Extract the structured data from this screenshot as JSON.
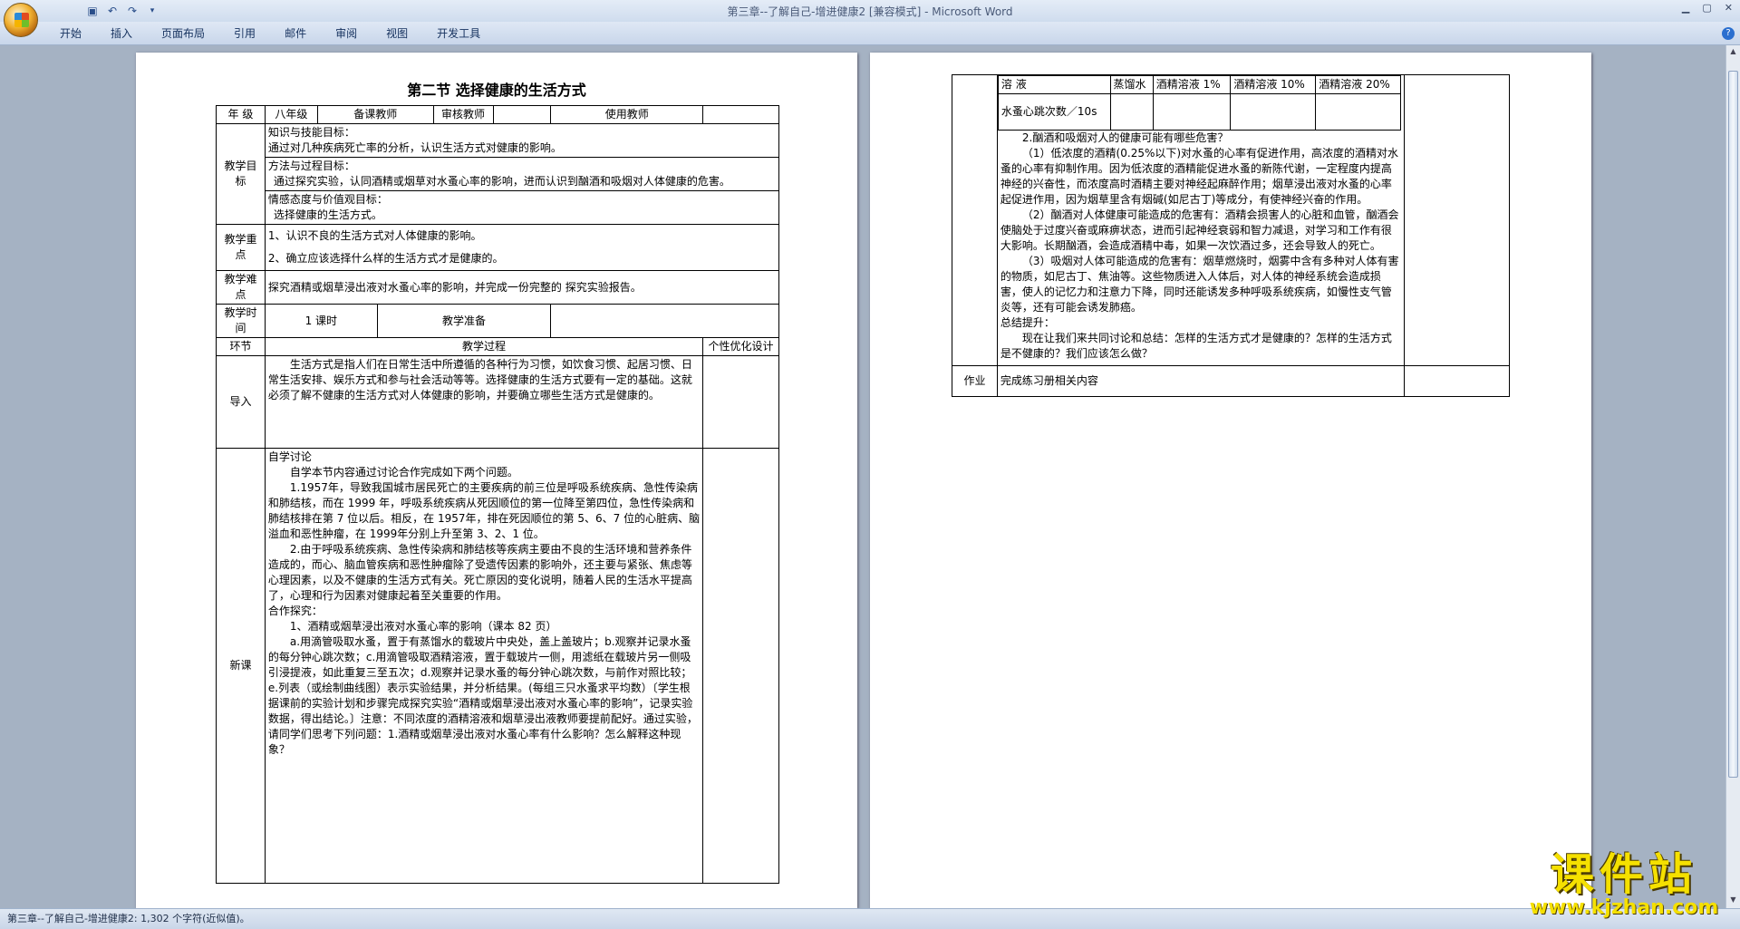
{
  "window": {
    "title": "第三章--了解自己-增进健康2 [兼容模式] - Microsoft Word"
  },
  "ribbon": {
    "tabs": [
      "开始",
      "插入",
      "页面布局",
      "引用",
      "邮件",
      "审阅",
      "视图",
      "开发工具"
    ]
  },
  "status": {
    "text": "第三章--了解自己-增进健康2: 1,302 个字符(近似值)。"
  },
  "watermark": {
    "title": "课件站",
    "url": "www.kjzhan.com"
  },
  "page1": {
    "title": "第二节 选择健康的生活方式",
    "row_grade": {
      "l1": "年  级",
      "v1": "八年级",
      "l2": "备课教师",
      "l3": "审核教师",
      "l4": "使用教师"
    },
    "goals": {
      "label": "教学目标",
      "h1": "知识与技能目标：",
      "t1": "通过对几种疾病死亡率的分析，认识生活方式对健康的影响。",
      "h2": "方法与过程目标：",
      "t2": "通过探究实验，认同酒精或烟草对水蚤心率的影响，进而认识到酗酒和吸烟对人体健康的危害。",
      "h3": "情感态度与价值观目标：",
      "t3": "选择健康的生活方式。"
    },
    "keypoints": {
      "label": "教学重点",
      "k1": "1、认识不良的生活方式对人体健康的影响。",
      "k2": "2、确立应该选择什么样的生活方式才是健康的。"
    },
    "difficulty": {
      "label": "教学难点",
      "text": "探究酒精或烟草浸出液对水蚤心率的影响，并完成一份完整的   探究实验报告。"
    },
    "time": {
      "label": "教学时间",
      "value": "1  课时",
      "prep": "教学准备"
    },
    "header": {
      "c1": "环节",
      "c2": "教学过程",
      "c3": "个性优化设计"
    },
    "intro": {
      "label": "导入",
      "text": "生活方式是指人们在日常生活中所遵循的各种行为习惯，如饮食习惯、起居习惯、日常生活安排、娱乐方式和参与社会活动等等。选择健康的生活方式要有一定的基础。这就必须了解不健康的生活方式对人体健康的影响，并要确立哪些生活方式是健康的。"
    },
    "lesson": {
      "label": "新课",
      "h1": "自学讨论",
      "p1": "自学本节内容通过讨论合作完成如下两个问题。",
      "p2": "1.1957年，导致我国城市居民死亡的主要疾病的前三位是呼吸系统疾病、急性传染病和肺结核，而在 1999 年，呼吸系统疾病从死因顺位的第一位降至第四位，急性传染病和肺结核排在第 7 位以后。相反，在 1957年，排在死因顺位的第 5、6、7 位的心脏病、脑溢血和恶性肿瘤，在 1999年分别上升至第 3、2、1 位。",
      "p3": "2.由于呼吸系统疾病、急性传染病和肺结核等疾病主要由不良的生活环境和营养条件造成的，而心、脑血管疾病和恶性肿瘤除了受遗传因素的影响外，还主要与紧张、焦虑等心理因素，以及不健康的生活方式有关。死亡原因的变化说明，随着人民的生活水平提高了，心理和行为因素对健康起着至关重要的作用。",
      "h2": "合作探究：",
      "p4": "1、酒精或烟草浸出液对水蚤心率的影响（课本 82 页）",
      "p5": "a.用滴管吸取水蚤，置于有蒸馏水的载玻片中央处，盖上盖玻片；b.观察并记录水蚤的每分钟心跳次数；c.用滴管吸取酒精溶液，置于载玻片一侧，用滤纸在载玻片另一侧吸引浸提液，如此重复三至五次；d.观察并记录水蚤的每分钟心跳次数，与前作对照比较；e.列表（或绘制曲线图）表示实验结果，并分析结果。(每组三只水蚤求平均数）〔学生根据课前的实验计划和步骤完成探究实验“酒精或烟草浸出液对水蚤心率的影响”，记录实验数据，得出结论。〕注意：不同浓度的酒精溶液和烟草浸出液教师要提前配好。通过实验，请同学们思考下列问题：1.酒精或烟草浸出液对水蚤心率有什么影响？怎么解释这种现象？"
    }
  },
  "page2": {
    "inner": {
      "r1": [
        "溶  液",
        "蒸馏水",
        "酒精溶液 1%",
        "酒精溶液 10%",
        "酒精溶液 20%"
      ],
      "r2label": "水蚤心跳次数／10s"
    },
    "q2": "2.酗酒和吸烟对人的健康可能有哪些危害？",
    "a1": "（1）低浓度的酒精(0.25%以下)对水蚤的心率有促进作用，高浓度的酒精对水蚤的心率有抑制作用。因为低浓度的酒精能促进水蚤的新陈代谢，一定程度内提高神经的兴奋性，而浓度高时酒精主要对神经起麻醉作用；烟草浸出液对水蚤的心率起促进作用，因为烟草里含有烟碱(如尼古丁)等成分，有使神经兴奋的作用。",
    "a2": "（2）酗酒对人体健康可能造成的危害有：酒精会损害人的心脏和血管，酗酒会使脑处于过度兴奋或麻痹状态，进而引起神经衰弱和智力减退，对学习和工作有很大影响。长期酗酒，会造成酒精中毒，如果一次饮酒过多，还会导致人的死亡。",
    "a3": "（3）吸烟对人体可能造成的危害有：烟草燃烧时，烟雾中含有多种对人体有害的物质，如尼古丁、焦油等。这些物质进入人体后，对人体的神经系统会造成损害，使人的记忆力和注意力下降，同时还能诱发多种呼吸系统疾病，如慢性支气管炎等，还有可能会诱发肺癌。",
    "sum_h": "总结提升：",
    "sum": "现在让我们来共同讨论和总结：怎样的生活方式才是健康的？怎样的生活方式是不健康的？我们应该怎么做？",
    "hw_label": "作业",
    "hw_text": "完成练习册相关内容"
  }
}
